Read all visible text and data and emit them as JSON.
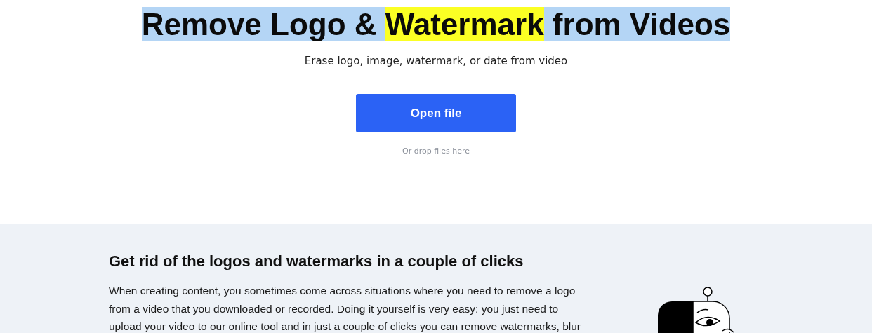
{
  "hero": {
    "title_selected": true,
    "title_parts": [
      {
        "text": "Remove Logo & ",
        "highlighted": false
      },
      {
        "text": "Watermark",
        "highlighted": true
      },
      {
        "text": " from Videos",
        "highlighted": false
      }
    ],
    "subtitle": "Erase logo, image, watermark, or date from video",
    "button": "Open file",
    "drop_hint": "Or drop files here"
  },
  "info": {
    "heading": "Get rid of the logos and watermarks in a couple of clicks",
    "paragraph": "When creating content, you sometimes come across situations where you need to remove a logo from a video that you downloaded or recorded. Doing it yourself is very easy: you just need to upload your video to our online tool and in just a couple of clicks you can remove watermarks, blur"
  }
}
